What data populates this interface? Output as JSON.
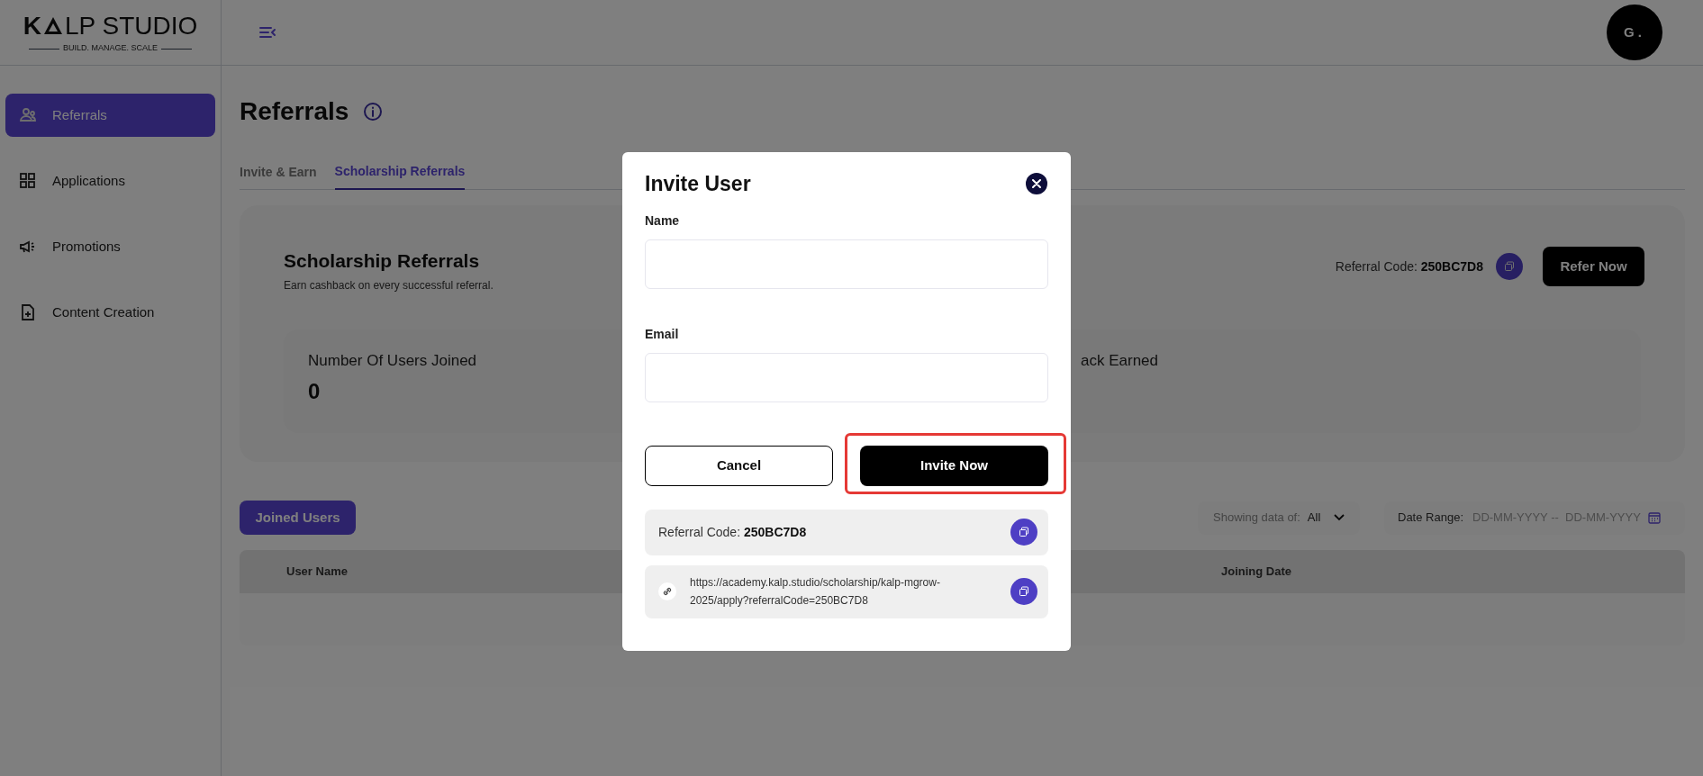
{
  "logo": {
    "left": "K",
    "right": "LP STUDIO",
    "tagline": "BUILD. MANAGE. SCALE"
  },
  "avatar": {
    "initials": "G."
  },
  "sidebar": {
    "items": [
      {
        "label": "Referrals",
        "selected": true
      },
      {
        "label": "Applications",
        "selected": false
      },
      {
        "label": "Promotions",
        "selected": false
      },
      {
        "label": "Content Creation",
        "selected": false
      }
    ]
  },
  "page": {
    "title": "Referrals"
  },
  "tabs": [
    {
      "label": "Invite & Earn",
      "selected": false
    },
    {
      "label": "Scholarship Referrals",
      "selected": true
    }
  ],
  "card": {
    "title": "Scholarship Referrals",
    "subtitle": "Earn cashback on every successful referral.",
    "code_label": "Referral Code:",
    "code": "250BC7D8",
    "button": "Refer Now",
    "stats": [
      {
        "label": "Number Of Users Joined",
        "value": "0"
      },
      {
        "label": "ack Earned"
      }
    ]
  },
  "joined_users_button": "Joined Users",
  "filter": {
    "label": "Showing data of:",
    "value": "All"
  },
  "date_range": {
    "label": "Date Range:",
    "placeholder": "DD-MM-YYYY --  DD-MM-YYYY"
  },
  "table": {
    "columns": [
      "User Name",
      "Joining Date"
    ]
  },
  "modal": {
    "title": "Invite User",
    "fields": [
      {
        "label": "Name"
      },
      {
        "label": "Email"
      }
    ],
    "cancel": "Cancel",
    "submit": "Invite Now",
    "submit_highlighted": true,
    "code_label": "Referral Code:",
    "code": "250BC7D8",
    "link": "https://academy.kalp.studio/scholarship/kalp-mgrow-2025/apply?referralCode=250BC7D8"
  }
}
